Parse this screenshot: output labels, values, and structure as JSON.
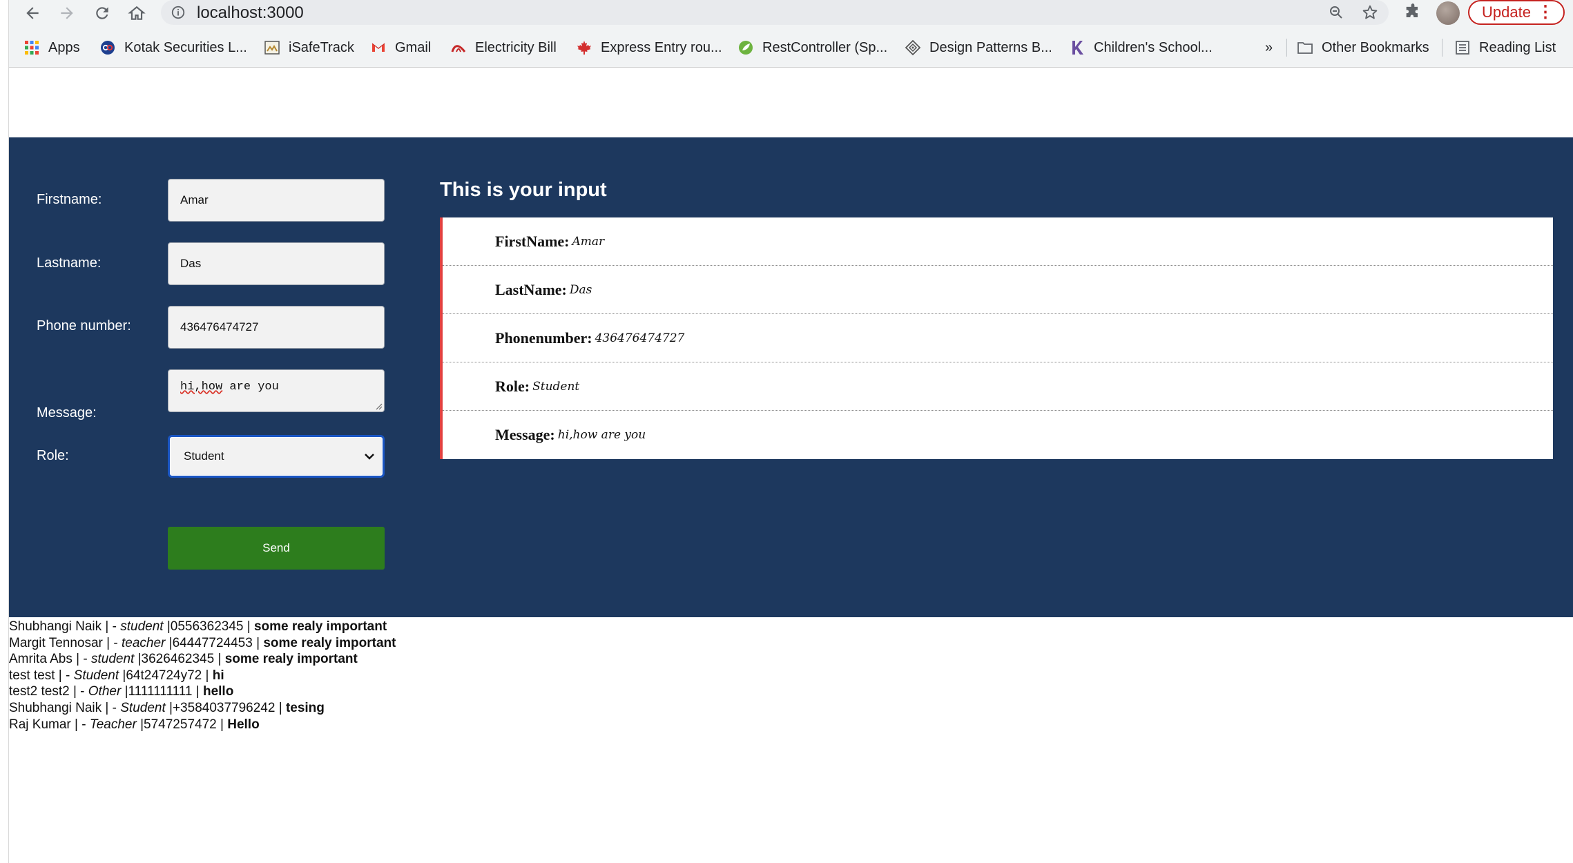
{
  "browser": {
    "url": "localhost:3000",
    "update_label": "Update",
    "bookmarks": [
      {
        "label": "Apps",
        "icon": "apps-grid-icon"
      },
      {
        "label": "Kotak Securities L...",
        "icon": "kotak-icon"
      },
      {
        "label": "iSafeTrack",
        "icon": "isafetrack-icon"
      },
      {
        "label": "Gmail",
        "icon": "gmail-icon"
      },
      {
        "label": "Electricity Bill",
        "icon": "electricity-icon"
      },
      {
        "label": "Express Entry rou...",
        "icon": "maple-leaf-icon"
      },
      {
        "label": "RestController (Sp...",
        "icon": "spring-icon"
      },
      {
        "label": "Design Patterns B...",
        "icon": "design-patterns-icon"
      },
      {
        "label": "Children's School...",
        "icon": "k-icon"
      }
    ],
    "overflow_label": "»",
    "other_bookmarks": "Other Bookmarks",
    "reading_list": "Reading List"
  },
  "form": {
    "firstname_label": "Firstname:",
    "firstname_value": "Amar",
    "lastname_label": "Lastname:",
    "lastname_value": "Das",
    "phone_label": "Phone number:",
    "phone_value": "436476474727",
    "message_label": "Message:",
    "message_value_misspelled": "hi,how",
    "message_value_rest": " are you",
    "role_label": "Role:",
    "role_value": "Student",
    "send_label": "Send"
  },
  "output": {
    "title": "This is your input",
    "rows": [
      {
        "key": "FirstName:",
        "value": "Amar"
      },
      {
        "key": "LastName:",
        "value": "Das"
      },
      {
        "key": "Phonenumber:",
        "value": "436476474727"
      },
      {
        "key": "Role:",
        "value": "Student"
      },
      {
        "key": "Message:",
        "value": "hi,how are you"
      }
    ]
  },
  "entries": [
    {
      "name": "Shubhangi Naik | - ",
      "role": "student",
      "phone": " |0556362345 | ",
      "message": "some realy important"
    },
    {
      "name": "Margit Tennosar | - ",
      "role": "teacher",
      "phone": " |64447724453 | ",
      "message": "some realy important"
    },
    {
      "name": "Amrita Abs | - ",
      "role": "student",
      "phone": " |3626462345 | ",
      "message": "some realy important"
    },
    {
      "name": "test test | - ",
      "role": "Student",
      "phone": " |64t24724y72 | ",
      "message": "hi"
    },
    {
      "name": "test2 test2 | - ",
      "role": "Other",
      "phone": " |1111111111 | ",
      "message": "hello"
    },
    {
      "name": "Shubhangi Naik | - ",
      "role": "Student",
      "phone": " |+3584037796242 | ",
      "message": "tesing"
    },
    {
      "name": "Raj Kumar | - ",
      "role": "Teacher",
      "phone": " |5747257472 | ",
      "message": "Hello"
    }
  ]
}
